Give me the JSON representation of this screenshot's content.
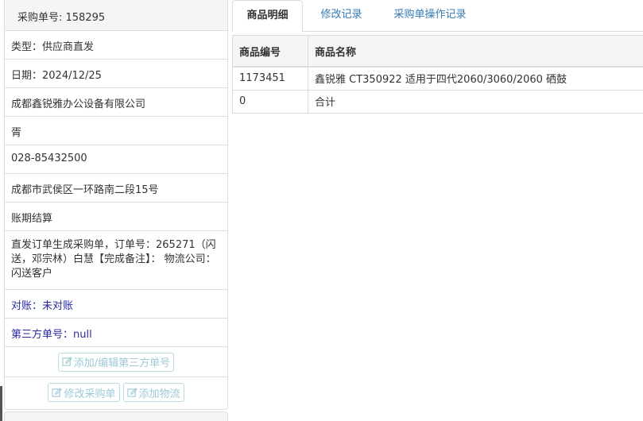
{
  "order_panel": {
    "header": "采购单号: 158295",
    "rows": [
      "类型：供应商直发",
      "日期：2024/12/25",
      "成都鑫锐雅办公设备有限公司",
      "胥",
      "028-85432500",
      "成都市武侯区一环路南二段15号",
      "账期结算",
      "直发订单生成采购单，订单号：265271（闪送，邓宗林）白慧【完成备注】： 物流公司：闪送客户",
      "对账：未对账",
      "第三方单号：null"
    ],
    "buttons": {
      "add_edit_third_party": "添加/编辑第三方单号",
      "edit_order": "修改采购单",
      "add_logistics": "添加物流"
    }
  },
  "tabs": [
    "商品明细",
    "修改记录",
    "采购单操作记录"
  ],
  "product_table": {
    "headers": [
      "商品编号",
      "商品名称"
    ],
    "rows": [
      [
        "1173451",
        "鑫锐雅 CT350922 适用于四代2060/3060/2060 硒鼓"
      ],
      [
        "0",
        "合计"
      ]
    ]
  },
  "colors": {
    "link_blue": "#337ab7",
    "status_blue": "#2a2aa0",
    "ghost_button": "#9ecad6",
    "panel_bg": "#f5f5f5",
    "border": "#dddddd"
  },
  "icons": {
    "button_icon": "edit-icon"
  }
}
